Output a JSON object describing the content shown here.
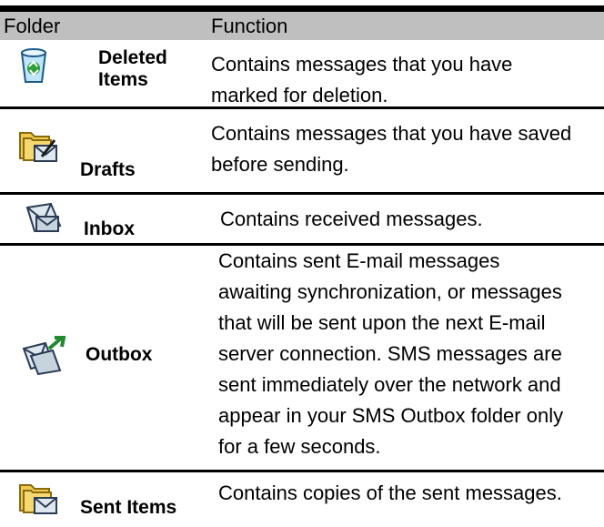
{
  "table": {
    "header": {
      "folder": "Folder",
      "function": "Function"
    },
    "rows": [
      {
        "name": "Deleted Items",
        "name_lines": [
          "Deleted",
          "Items"
        ],
        "icon": "recycle-bin-icon",
        "desc_lines": [
          "Contains messages that you have",
          "marked for deletion."
        ]
      },
      {
        "name": "Drafts",
        "icon": "drafts-folder-icon",
        "desc_lines": [
          "Contains messages that you have saved",
          "before sending."
        ]
      },
      {
        "name": "Inbox",
        "icon": "inbox-folder-icon",
        "desc_lines": [
          "Contains received messages."
        ]
      },
      {
        "name": "Outbox",
        "icon": "outbox-folder-icon",
        "desc_lines": [
          "Contains sent E-mail messages",
          "awaiting synchronization, or messages",
          "that will be sent upon the next E-mail",
          "server connection. SMS messages are",
          "sent immediately over the network and",
          "appear in your SMS Outbox folder only",
          "for a few seconds."
        ]
      },
      {
        "name": "Sent Items",
        "icon": "sent-items-folder-icon",
        "desc_lines": [
          "Contains copies of the sent messages."
        ]
      }
    ]
  }
}
